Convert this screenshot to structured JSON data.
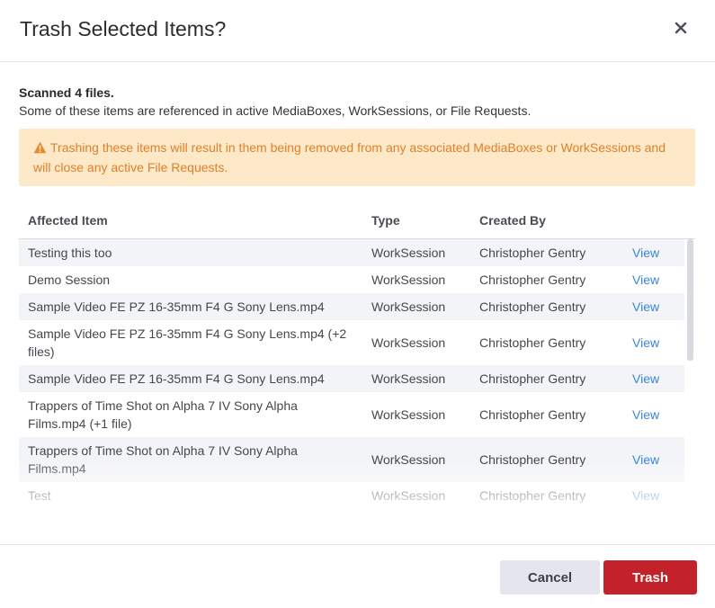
{
  "dialog": {
    "title": "Trash Selected Items?",
    "close_icon": "close-icon"
  },
  "summary": {
    "scanned": "Scanned 4 files.",
    "description": "Some of these items are referenced in active MediaBoxes, WorkSessions, or File Requests."
  },
  "warning": {
    "icon": "warning-triangle-icon",
    "text": "Trashing these items will result in them being removed from any associated MediaBoxes or WorkSessions and will close any active File Requests.",
    "color": "#e0802a",
    "background": "#fde8c8"
  },
  "table": {
    "columns": [
      "Affected Item",
      "Type",
      "Created By"
    ],
    "rows": [
      {
        "item": "Testing this too",
        "type": "WorkSession",
        "created_by": "Christopher Gentry",
        "action": "View"
      },
      {
        "item": "Demo Session",
        "type": "WorkSession",
        "created_by": "Christopher Gentry",
        "action": "View"
      },
      {
        "item": "Sample Video FE PZ 16-35mm F4 G Sony Lens.mp4",
        "type": "WorkSession",
        "created_by": "Christopher Gentry",
        "action": "View"
      },
      {
        "item": "Sample Video FE PZ 16-35mm F4 G Sony Lens.mp4 (+2 files)",
        "type": "WorkSession",
        "created_by": "Christopher Gentry",
        "action": "View"
      },
      {
        "item": "Sample Video FE PZ 16-35mm F4 G Sony Lens.mp4",
        "type": "WorkSession",
        "created_by": "Christopher Gentry",
        "action": "View"
      },
      {
        "item": "Trappers of Time Shot on Alpha 7 IV Sony Alpha Films.mp4 (+1 file)",
        "type": "WorkSession",
        "created_by": "Christopher Gentry",
        "action": "View"
      },
      {
        "item": "Trappers of Time Shot on Alpha 7 IV Sony Alpha Films.mp4",
        "type": "WorkSession",
        "created_by": "Christopher Gentry",
        "action": "View"
      },
      {
        "item": "Test",
        "type": "WorkSession",
        "created_by": "Christopher Gentry",
        "action": "View"
      }
    ]
  },
  "footer": {
    "cancel_label": "Cancel",
    "trash_label": "Trash",
    "trash_color": "#c4222a"
  }
}
